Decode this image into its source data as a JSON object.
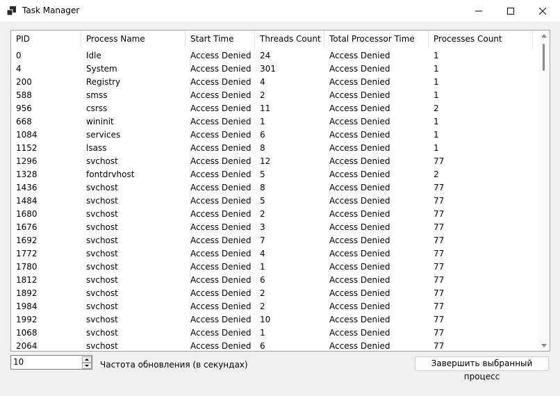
{
  "window": {
    "title": "Task Manager"
  },
  "table": {
    "columns": [
      "PID",
      "Process Name",
      "Start Time",
      "Threads Count",
      "Total Processor Time",
      "Processes Count"
    ],
    "rows": [
      [
        "0",
        "Idle",
        "Access Denied",
        "24",
        "Access Denied",
        "1"
      ],
      [
        "4",
        "System",
        "Access Denied",
        "301",
        "Access Denied",
        "1"
      ],
      [
        "200",
        "Registry",
        "Access Denied",
        "4",
        "Access Denied",
        "1"
      ],
      [
        "588",
        "smss",
        "Access Denied",
        "2",
        "Access Denied",
        "1"
      ],
      [
        "956",
        "csrss",
        "Access Denied",
        "11",
        "Access Denied",
        "2"
      ],
      [
        "668",
        "wininit",
        "Access Denied",
        "1",
        "Access Denied",
        "1"
      ],
      [
        "1084",
        "services",
        "Access Denied",
        "6",
        "Access Denied",
        "1"
      ],
      [
        "1152",
        "lsass",
        "Access Denied",
        "8",
        "Access Denied",
        "1"
      ],
      [
        "1296",
        "svchost",
        "Access Denied",
        "12",
        "Access Denied",
        "77"
      ],
      [
        "1328",
        "fontdrvhost",
        "Access Denied",
        "5",
        "Access Denied",
        "2"
      ],
      [
        "1436",
        "svchost",
        "Access Denied",
        "8",
        "Access Denied",
        "77"
      ],
      [
        "1484",
        "svchost",
        "Access Denied",
        "5",
        "Access Denied",
        "77"
      ],
      [
        "1680",
        "svchost",
        "Access Denied",
        "2",
        "Access Denied",
        "77"
      ],
      [
        "1676",
        "svchost",
        "Access Denied",
        "3",
        "Access Denied",
        "77"
      ],
      [
        "1692",
        "svchost",
        "Access Denied",
        "7",
        "Access Denied",
        "77"
      ],
      [
        "1772",
        "svchost",
        "Access Denied",
        "4",
        "Access Denied",
        "77"
      ],
      [
        "1780",
        "svchost",
        "Access Denied",
        "1",
        "Access Denied",
        "77"
      ],
      [
        "1812",
        "svchost",
        "Access Denied",
        "6",
        "Access Denied",
        "77"
      ],
      [
        "1892",
        "svchost",
        "Access Denied",
        "2",
        "Access Denied",
        "77"
      ],
      [
        "1984",
        "svchost",
        "Access Denied",
        "2",
        "Access Denied",
        "77"
      ],
      [
        "1992",
        "svchost",
        "Access Denied",
        "10",
        "Access Denied",
        "77"
      ],
      [
        "1068",
        "svchost",
        "Access Denied",
        "1",
        "Access Denied",
        "77"
      ],
      [
        "2064",
        "svchost",
        "Access Denied",
        "6",
        "Access Denied",
        "77"
      ]
    ]
  },
  "controls": {
    "refresh_value": "10",
    "refresh_label": "Частота обновления (в секундах)",
    "end_process_label": "Завершить выбранный процесс"
  }
}
